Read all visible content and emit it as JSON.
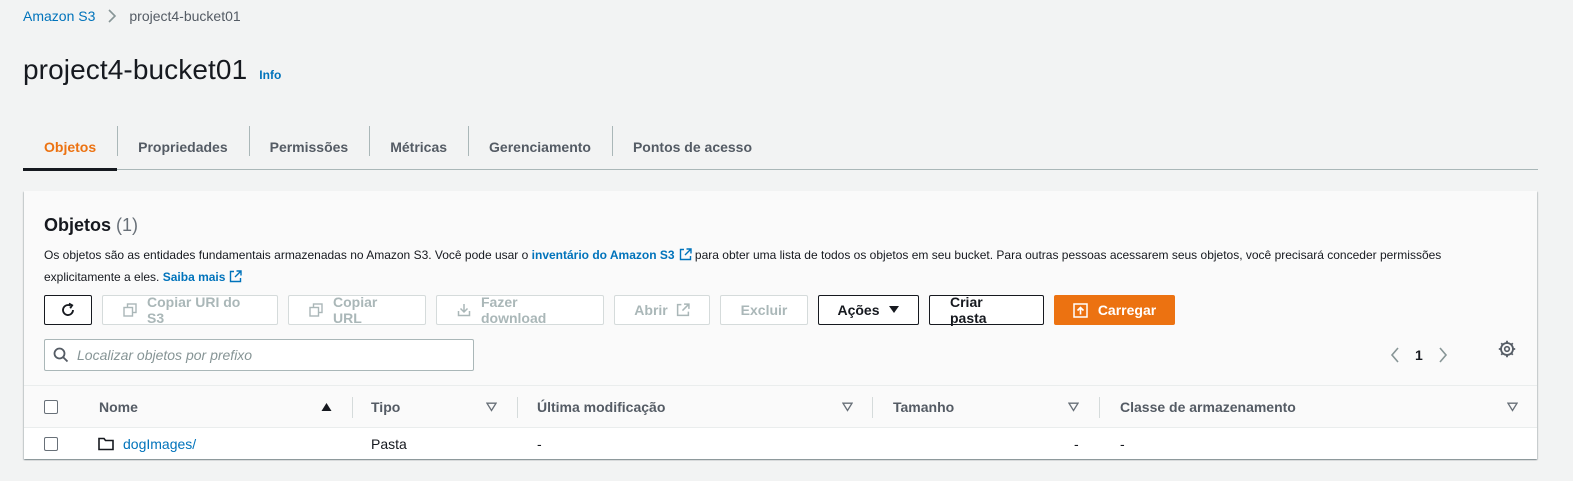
{
  "breadcrumb": {
    "root": "Amazon S3",
    "current": "project4-bucket01"
  },
  "header": {
    "title": "project4-bucket01",
    "info": "Info"
  },
  "tabs": [
    {
      "label": "Objetos",
      "active": true
    },
    {
      "label": "Propriedades"
    },
    {
      "label": "Permissões"
    },
    {
      "label": "Métricas"
    },
    {
      "label": "Gerenciamento"
    },
    {
      "label": "Pontos de acesso"
    }
  ],
  "panel": {
    "title": "Objetos",
    "count": "(1)",
    "desc_part1": "Os objetos são as entidades fundamentais armazenadas no Amazon S3. Você pode usar o ",
    "desc_link1": "inventário do Amazon S3",
    "desc_part2": " para obter uma lista de todos os objetos em seu bucket. Para outras pessoas acessarem seus objetos, você precisará conceder permissões explicitamente a eles. ",
    "desc_link2": "Saiba mais"
  },
  "toolbar": {
    "copy_uri": "Copiar URI do S3",
    "copy_url": "Copiar URL",
    "download": "Fazer download",
    "open": "Abrir",
    "delete": "Excluir",
    "actions": "Ações",
    "create_folder": "Criar pasta",
    "upload": "Carregar"
  },
  "search": {
    "placeholder": "Localizar objetos por prefixo",
    "value": ""
  },
  "pagination": {
    "page": "1"
  },
  "table": {
    "columns": {
      "name": "Nome",
      "type": "Tipo",
      "modified": "Última modificação",
      "size": "Tamanho",
      "storage_class": "Classe de armazenamento"
    },
    "rows": [
      {
        "name": "dogImages/",
        "type": "Pasta",
        "modified": "-",
        "size": "-",
        "storage_class": "-"
      }
    ]
  },
  "colors": {
    "accent": "#ec7211",
    "link": "#0073bb",
    "text": "#16191f",
    "muted": "#545b64"
  }
}
